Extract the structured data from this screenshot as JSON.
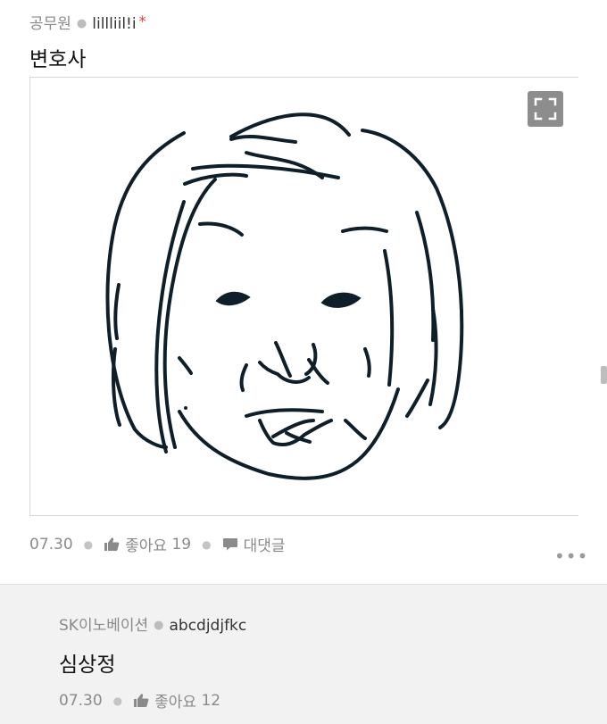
{
  "comment1": {
    "author_org": "공무원",
    "nickname": "lillliil!i",
    "badge": "*",
    "text": "변호사",
    "date": "07.30",
    "like_label": "좋아요",
    "like_count": "19",
    "reply_label": "대댓글",
    "image_icons": {
      "expand": "expand-icon"
    },
    "more_icon": "more-dots-icon"
  },
  "comment2": {
    "author_org": "SK이노베이션",
    "nickname": "abcdjdjfkc",
    "text": "심상정",
    "date": "07.30",
    "like_label": "좋아요",
    "like_count": "12"
  },
  "colors": {
    "badge": "#e0392b",
    "reply_bg": "#f2f2f2",
    "drawing_stroke": "#0f1f2a"
  }
}
